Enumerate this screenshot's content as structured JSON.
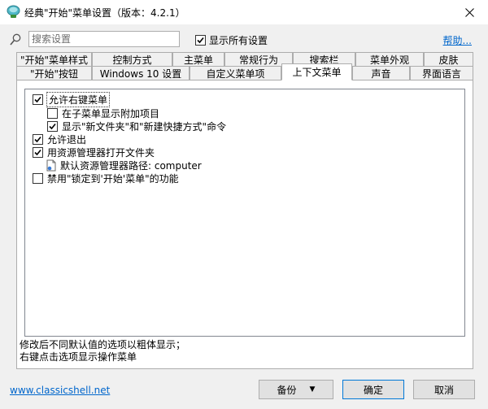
{
  "window": {
    "title": "经典\"开始\"菜单设置（版本：4.2.1）"
  },
  "search": {
    "placeholder": "搜索设置",
    "show_all_label": "显示所有设置",
    "show_all_checked": true,
    "help_link": "帮助..."
  },
  "tabs": {
    "row1": [
      "\"开始\"菜单样式",
      "控制方式",
      "主菜单",
      "常规行为",
      "搜索栏",
      "菜单外观",
      "皮肤"
    ],
    "row2": [
      "\"开始\"按钮",
      "Windows 10 设置",
      "自定义菜单项",
      "上下文菜单",
      "声音",
      "界面语言"
    ],
    "active": "上下文菜单"
  },
  "options": [
    {
      "label": "允许右键菜单",
      "checked": true,
      "indent": 0,
      "selected": true
    },
    {
      "label": "在子菜单显示附加项目",
      "checked": false,
      "indent": 1
    },
    {
      "label": "显示\"新文件夹\"和\"新建快捷方式\"命令",
      "checked": true,
      "indent": 1
    },
    {
      "label": "允许退出",
      "checked": true,
      "indent": 0
    },
    {
      "label": "用资源管理器打开文件夹",
      "checked": true,
      "indent": 0
    },
    {
      "label": "默认资源管理器路径: computer",
      "checked": null,
      "indent": 1,
      "icon": "file-icon"
    },
    {
      "label": "禁用\"锁定到'开始'菜单\"的功能",
      "checked": false,
      "indent": 0
    }
  ],
  "note": {
    "line1": "修改后不同默认值的选项以粗体显示；",
    "line2": "右键点击选项显示操作菜单"
  },
  "footer": {
    "site_link": "www.classicshell.net",
    "backup_label": "备份",
    "ok_label": "确定",
    "cancel_label": "取消"
  },
  "colors": {
    "link": "#0066cc",
    "title_bg": "#ffffff",
    "window_bg": "#f0f0f0",
    "ok_border": "#0078d7"
  }
}
